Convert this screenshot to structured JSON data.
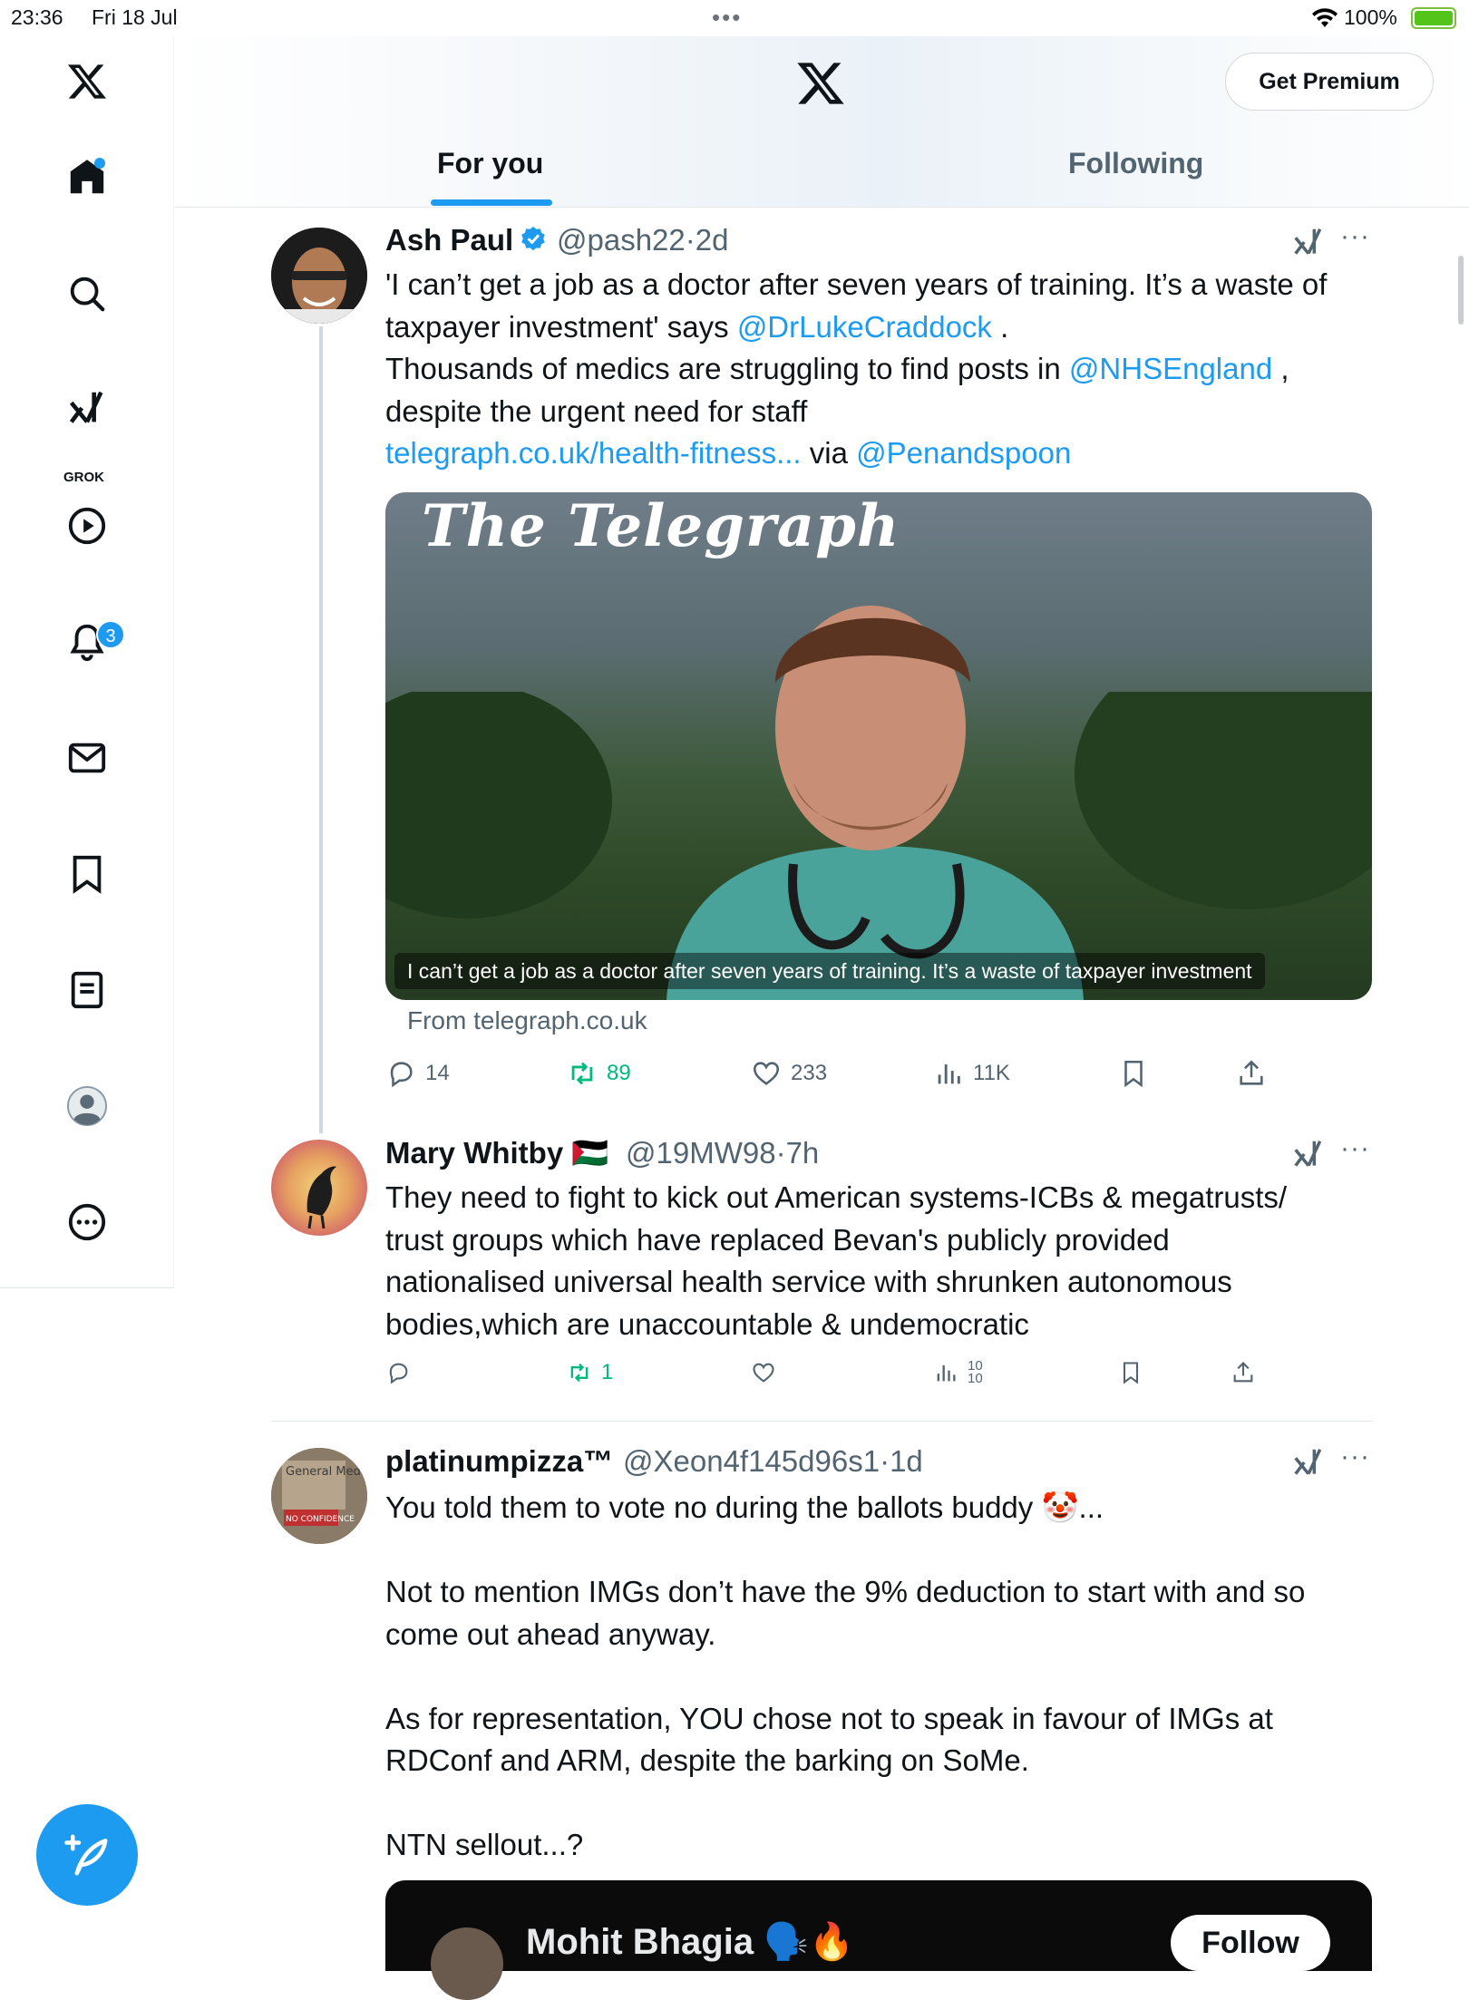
{
  "status_bar": {
    "time": "23:36",
    "date": "Fri 18 Jul",
    "battery": "100%"
  },
  "sidebar": {
    "grok_label": "GROK",
    "notifications_badge": "3",
    "items": [
      "x-logo",
      "home",
      "search",
      "grok",
      "videos",
      "notifications",
      "messages",
      "bookmarks",
      "lists",
      "profile",
      "more"
    ]
  },
  "header": {
    "premium_button": "Get Premium",
    "tabs": [
      {
        "label": "For you",
        "active": true
      },
      {
        "label": "Following",
        "active": false
      }
    ]
  },
  "tweets": [
    {
      "name": "Ash Paul",
      "verified": true,
      "handle": "@pash22",
      "time": "2d",
      "text_lines": [
        "'I can’t get a job as a doctor after seven years of training. It’s a waste of",
        "taxpayer investment' says",
        "@DrLukeCraddock",
        ".",
        "Thousands of medics are struggling to find posts in",
        "@NHSEngland",
        ",",
        "despite the urgent need for staff",
        "telegraph.co.uk/health-fitness...",
        "via",
        "@Penandspoon"
      ],
      "card": {
        "brand": "The Telegraph",
        "caption": "I can’t get a job as a doctor after seven years of training. It’s a waste of taxpayer investment",
        "from": "From telegraph.co.uk"
      },
      "stats": {
        "replies": "14",
        "retweets": "89",
        "likes": "233",
        "views": "11K"
      }
    },
    {
      "name": "Mary Whitby",
      "flag": "🇵🇸",
      "handle": "@19MW98",
      "time": "7h",
      "text_lines": [
        "They need to fight to kick out American systems-ICBs & megatrusts/",
        "trust groups which have replaced Bevan's publicly provided",
        "nationalised universal health service with shrunken autonomous",
        "bodies,which are unaccountable & undemocratic"
      ],
      "stats": {
        "replies": "",
        "retweets": "1",
        "likes": "",
        "views_top": "10",
        "views_bottom": "10"
      }
    },
    {
      "name": "platinumpizza™",
      "handle": "@Xeon4f145d96s1",
      "time": "1d",
      "avatar_sign": "General Medical Council",
      "avatar_sign_bottom": "NO CONFIDENCE",
      "text_lines": [
        "You told them to vote no during the ballots buddy 🤡...",
        "Not to mention IMGs don’t have the 9% deduction to start with and so",
        "come out ahead anyway.",
        "As for representation, YOU chose not to speak in favour of IMGs at",
        "RDConf and ARM, despite the barking on SoMe.",
        "NTN sellout...?"
      ],
      "embed": {
        "name": "Mohit Bhagia 🗣️🔥",
        "follow": "Follow"
      }
    }
  ],
  "colors": {
    "accent": "#1d9bf0",
    "retweet_green": "#00ba7c",
    "text": "#0f1419",
    "muted": "#536471"
  }
}
